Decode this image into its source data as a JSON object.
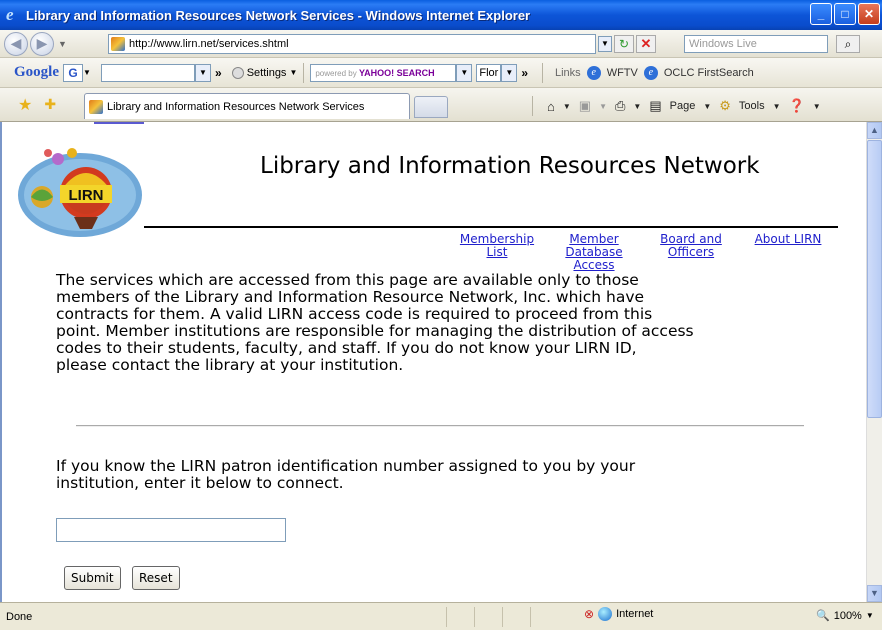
{
  "window": {
    "title": "Library and Information Resources Network Services - Windows Internet Explorer",
    "controls": {
      "minimize": "_",
      "maximize": "□",
      "close": "✕"
    }
  },
  "address_bar": {
    "url": "http://www.lirn.net/services.shtml",
    "search_placeholder": "Windows Live"
  },
  "toolbar": {
    "google_logo": "Google",
    "google_btn": "G",
    "settings_label": "Settings",
    "yahoo_prefix": "powered by",
    "yahoo_brand": "YAHOO! SEARCH",
    "flor_value": "Flor",
    "links_label": "Links",
    "link1": "WFTV",
    "link2": "OCLC FirstSearch"
  },
  "tabs": {
    "active_tab": "Library and Information Resources Network Services",
    "page_menu": "Page",
    "tools_menu": "Tools"
  },
  "page": {
    "logo_text": "LIRN",
    "title": "Library and Information Resources Network",
    "nav": {
      "membership": [
        "Membership",
        "List"
      ],
      "member_db": [
        "Member",
        "Database",
        "Access"
      ],
      "board": [
        "Board and",
        "Officers"
      ],
      "about": "About LIRN"
    },
    "intro_lines": [
      "The services which are accessed from this page are available only to those",
      "members of the Library and Information Resource Network, Inc. which have",
      "contracts for them. A valid LIRN access code is required to proceed from this",
      "point. Member institutions are responsible for managing the distribution of access",
      "codes to their students, faculty, and staff. If you do not know your LIRN ID,",
      "please contact the library at your institution."
    ],
    "id_prompt_lines": [
      "If you know the LIRN patron identification number assigned to you by your",
      "institution, enter it below to connect."
    ],
    "id_input_value": "",
    "submit_label": "Submit",
    "reset_label": "Reset"
  },
  "status": {
    "text": "Done",
    "zone": "Internet",
    "zoom": "100%"
  }
}
